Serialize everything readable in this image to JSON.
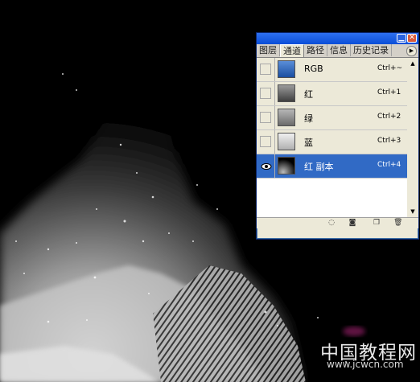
{
  "palette": {
    "tabs": [
      "图层",
      "通道",
      "路径",
      "信息",
      "历史记录"
    ],
    "active_tab": 1,
    "channels": [
      {
        "name": "RGB",
        "shortcut": "Ctrl+~",
        "visible": false,
        "selected": false,
        "thumb": "#3a6ea5"
      },
      {
        "name": "红",
        "shortcut": "Ctrl+1",
        "visible": false,
        "selected": false,
        "thumb": "#707070"
      },
      {
        "name": "绿",
        "shortcut": "Ctrl+2",
        "visible": false,
        "selected": false,
        "thumb": "#9a9a9a"
      },
      {
        "name": "蓝",
        "shortcut": "Ctrl+3",
        "visible": false,
        "selected": false,
        "thumb": "#d8d8d8"
      },
      {
        "name": "红 副本",
        "shortcut": "Ctrl+4",
        "visible": true,
        "selected": true,
        "thumb": "#000000"
      }
    ]
  },
  "watermark": {
    "title": "中国教程网",
    "url": "www.jcwcn.com"
  },
  "colors": {
    "selection": "#316ac5",
    "titlebar": "#0a4ed8",
    "canvas_bg": "#000000"
  }
}
